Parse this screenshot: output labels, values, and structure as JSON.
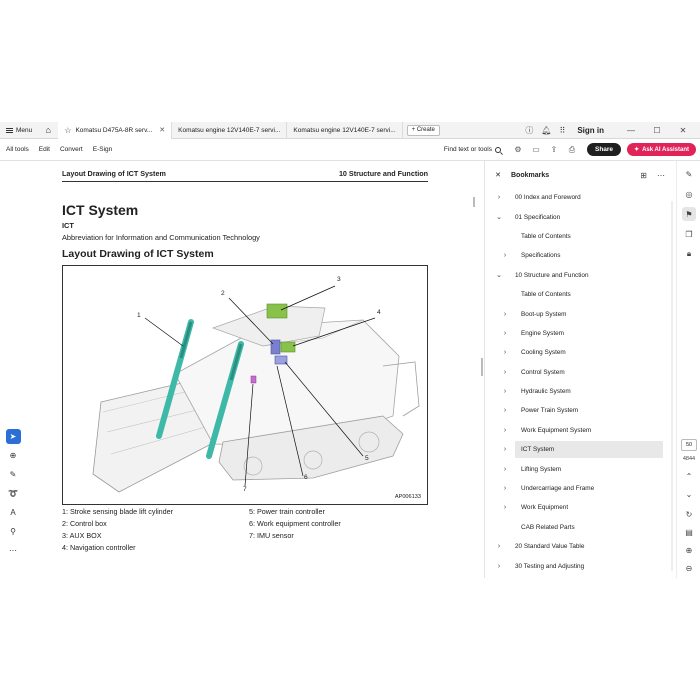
{
  "window": {
    "menu_label": "Menu",
    "tabs": [
      {
        "label": "Komatsu D475A-8R serv...",
        "active": true
      },
      {
        "label": "Komatsu engine 12V140E-7 servi...",
        "active": false
      },
      {
        "label": "Komatsu engine 12V140E-7 servi...",
        "active": false
      }
    ],
    "create_label": "Create",
    "signin_label": "Sign in"
  },
  "toolbar": {
    "items": [
      "All tools",
      "Edit",
      "Convert",
      "E-Sign"
    ],
    "find_label": "Find text or tools",
    "share_label": "Share",
    "ai_label": "Ask AI Assistant",
    "ai_color": "#e0245a"
  },
  "document": {
    "running_left": "Layout Drawing of ICT System",
    "running_right": "10 Structure and Function",
    "title": "ICT System",
    "abbr": "ICT",
    "abbr_desc": "Abbreviation for Information and Communication Technology",
    "section": "Layout Drawing of ICT System",
    "figure_code": "AP006133",
    "callouts": [
      "1",
      "2",
      "3",
      "4",
      "5",
      "6",
      "7"
    ],
    "legend": [
      "1: Stroke sensing blade lift cylinder",
      "2: Control box",
      "3: AUX BOX",
      "4: Navigation controller",
      "5: Power train controller",
      "6: Work equipment controller",
      "7: IMU sensor"
    ]
  },
  "bookmarks": {
    "title": "Bookmarks",
    "items": [
      {
        "label": "00 Index and Foreword",
        "level": 0,
        "state": "collapsed"
      },
      {
        "label": "01 Specification",
        "level": 0,
        "state": "expanded"
      },
      {
        "label": "Table of Contents",
        "level": 1,
        "state": "leaf"
      },
      {
        "label": "Specifications",
        "level": 1,
        "state": "collapsed"
      },
      {
        "label": "10 Structure and Function",
        "level": 0,
        "state": "expanded"
      },
      {
        "label": "Table of Contents",
        "level": 1,
        "state": "leaf"
      },
      {
        "label": "Boot-up System",
        "level": 1,
        "state": "collapsed"
      },
      {
        "label": "Engine System",
        "level": 1,
        "state": "collapsed"
      },
      {
        "label": "Cooling System",
        "level": 1,
        "state": "collapsed"
      },
      {
        "label": "Control System",
        "level": 1,
        "state": "collapsed"
      },
      {
        "label": "Hydraulic System",
        "level": 1,
        "state": "collapsed"
      },
      {
        "label": "Power Train System",
        "level": 1,
        "state": "collapsed"
      },
      {
        "label": "Work Equipment System",
        "level": 1,
        "state": "collapsed"
      },
      {
        "label": "ICT System",
        "level": 1,
        "state": "collapsed",
        "selected": true
      },
      {
        "label": "Lifting System",
        "level": 1,
        "state": "collapsed"
      },
      {
        "label": "Undercarriage and Frame",
        "level": 1,
        "state": "collapsed"
      },
      {
        "label": "Work Equipment",
        "level": 1,
        "state": "collapsed"
      },
      {
        "label": "CAB Related Parts",
        "level": 1,
        "state": "leaf"
      },
      {
        "label": "20 Standard Value Table",
        "level": 0,
        "state": "collapsed"
      },
      {
        "label": "30 Testing and Adjusting",
        "level": 0,
        "state": "collapsed"
      }
    ]
  },
  "page_nav": {
    "current": "50",
    "total": "4844"
  },
  "colors": {
    "cylinder": "#3fb9a7",
    "controller": "#88c24a",
    "accent_blue": "#2b6fd6"
  }
}
